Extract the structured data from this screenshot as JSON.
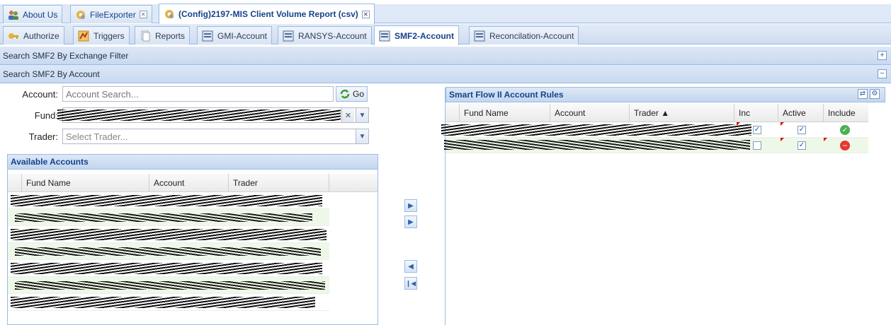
{
  "doc_tabs": [
    {
      "label": "About Us",
      "icon": "users-icon",
      "closable": false,
      "active": false
    },
    {
      "label": "FileExporter",
      "icon": "gear-icon",
      "closable": true,
      "active": false
    },
    {
      "label": "(Config)2197-MIS Client Volume Report (csv)",
      "icon": "gear-icon",
      "closable": true,
      "active": true
    }
  ],
  "sub_tabs": [
    {
      "label": "Authorize",
      "icon": "key-icon",
      "active": false
    },
    {
      "label": "Triggers",
      "icon": "triggers-icon",
      "active": false
    },
    {
      "label": "Reports",
      "icon": "reports-icon",
      "active": false
    },
    {
      "label": "GMI-Account",
      "icon": "grid-icon",
      "active": false
    },
    {
      "label": "RANSYS-Account",
      "icon": "grid-icon",
      "active": false
    },
    {
      "label": "SMF2-Account",
      "icon": "grid-icon",
      "active": true
    },
    {
      "label": "Reconcilation-Account",
      "icon": "grid-icon",
      "active": false
    }
  ],
  "sections": {
    "exchange_filter": {
      "title": "Search SMF2 By Exchange Filter",
      "toggle": "+"
    },
    "by_account": {
      "title": "Search SMF2 By Account",
      "toggle": "−"
    }
  },
  "form": {
    "account_label": "Account:",
    "account_placeholder": "Account Search...",
    "go_label": "Go",
    "fund_label": "Fund:",
    "trader_label": "Trader:",
    "trader_placeholder": "Select Trader..."
  },
  "available_accounts": {
    "title": "Available Accounts",
    "columns": [
      "Fund Name",
      "Account",
      "Trader"
    ],
    "row_count": 7
  },
  "rules": {
    "title": "Smart Flow II Account Rules",
    "columns": [
      "Fund Name",
      "Account",
      "Trader ▲",
      "Inc",
      "Active",
      "Include"
    ],
    "rows": [
      {
        "inc": true,
        "active": true,
        "include": "ok"
      },
      {
        "inc": false,
        "active": true,
        "include": "no"
      }
    ]
  },
  "move_buttons": [
    "move-right",
    "move-all-right",
    "move-left",
    "move-all-left"
  ]
}
